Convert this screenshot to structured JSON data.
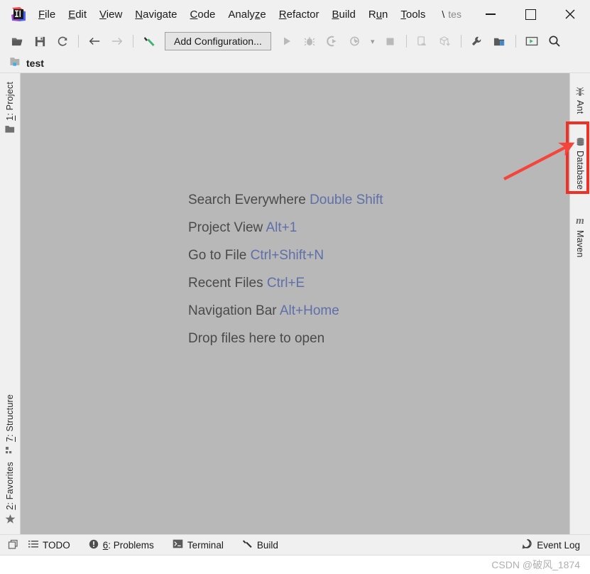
{
  "window": {
    "menu_items": [
      {
        "label": "File",
        "mnemonic": "F"
      },
      {
        "label": "Edit",
        "mnemonic": "E"
      },
      {
        "label": "View",
        "mnemonic": "V"
      },
      {
        "label": "Navigate",
        "mnemonic": "N"
      },
      {
        "label": "Code",
        "mnemonic": "C"
      },
      {
        "label": "Analyze",
        "mnemonic": "z"
      },
      {
        "label": "Refactor",
        "mnemonic": "R"
      },
      {
        "label": "Build",
        "mnemonic": "B"
      },
      {
        "label": "Run",
        "mnemonic": "u"
      },
      {
        "label": "Tools",
        "mnemonic": "T"
      }
    ],
    "path_separator": "\\",
    "path_truncated": "tes",
    "minimize_label": "—",
    "maximize_label": "□",
    "close_label": "✕",
    "logo_name": "intellij-idea-logo"
  },
  "toolbar": {
    "open_title": "Open",
    "save_title": "Save All",
    "sync_title": "Synchronize",
    "back_title": "Back",
    "forward_title": "Forward",
    "build_title": "Build Project",
    "add_configuration_label": "Add Configuration...",
    "run_title": "Run",
    "debug_title": "Debug",
    "run_coverage_title": "Run with Coverage",
    "profiler_title": "Profiler",
    "profiler_dropdown": "▾",
    "stop_title": "Stop",
    "device_title": "Device Manager",
    "sync_gradle_title": "Sync Project",
    "settings_title": "Settings",
    "project_structure_title": "Project Structure",
    "terminal_title": "Terminal",
    "search_title": "Search Everywhere"
  },
  "breadcrumb": {
    "project_name": "test",
    "icon": "project-folder-icon"
  },
  "left_sidebar": {
    "top_tabs": [
      {
        "label": "1: Project",
        "mnemonic": "1",
        "icon": "folder-icon"
      }
    ],
    "bottom_tabs": [
      {
        "label": "7: Structure",
        "mnemonic": "7",
        "icon": "structure-icon"
      },
      {
        "label": "2: Favorites",
        "mnemonic": "2",
        "icon": "star-icon"
      }
    ]
  },
  "right_sidebar": {
    "tabs": [
      {
        "label": "Ant",
        "icon": "ant-icon",
        "highlighted": false
      },
      {
        "label": "Database",
        "icon": "database-icon",
        "highlighted": true
      },
      {
        "label": "Maven",
        "icon": "maven-icon",
        "highlighted": false
      }
    ]
  },
  "editor": {
    "hints": [
      {
        "action": "Search Everywhere",
        "shortcut": "Double Shift"
      },
      {
        "action": "Project View",
        "shortcut": "Alt+1"
      },
      {
        "action": "Go to File",
        "shortcut": "Ctrl+Shift+N"
      },
      {
        "action": "Recent Files",
        "shortcut": "Ctrl+E"
      },
      {
        "action": "Navigation Bar",
        "shortcut": "Alt+Home"
      },
      {
        "action": "Drop files here to open",
        "shortcut": ""
      }
    ]
  },
  "statusbar": {
    "items": [
      {
        "label": "TODO",
        "icon": "todo-list-icon"
      },
      {
        "label": "6: Problems",
        "mnemonic": "6",
        "icon": "problems-icon"
      },
      {
        "label": "Terminal",
        "icon": "terminal-icon"
      },
      {
        "label": "Build",
        "icon": "build-hammer-icon"
      }
    ],
    "event_log_label": "Event Log",
    "event_log_icon": "event-log-icon",
    "restore_layout_icon": "restore-layout-icon"
  },
  "watermark": {
    "text": "CSDN @破风_1874"
  },
  "annotation": {
    "highlight_color": "#ee3124",
    "arrow_color": "#f5453a",
    "highlight_target": "Database"
  },
  "colors": {
    "window_bg": "#f0f0f0",
    "editor_bg": "#b8b8b8",
    "hint_text": "#4a4a4a",
    "hint_key": "#5f6fa8"
  }
}
